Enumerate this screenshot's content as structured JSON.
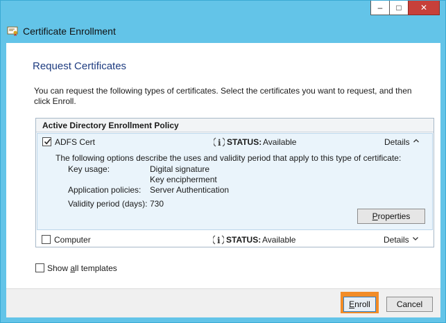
{
  "window": {
    "title": "Certificate Enrollment",
    "controls": {
      "minimize": "–",
      "maximize": "□",
      "close": "✕"
    }
  },
  "page": {
    "heading": "Request Certificates",
    "description": "You can request the following types of certificates. Select the certificates you want to request, and then click Enroll."
  },
  "policy": {
    "header": "Active Directory Enrollment Policy",
    "items": [
      {
        "name": "ADFS Cert",
        "checked": true,
        "status_label": "STATUS:",
        "status_value": "Available",
        "details_label": "Details",
        "expanded": true,
        "options_description": "The following options describe the uses and validity period that apply to this type of certificate:",
        "key_usage_label": "Key usage:",
        "key_usage_values": [
          "Digital signature",
          "Key encipherment"
        ],
        "app_policies_label": "Application policies:",
        "app_policies_value": "Server Authentication",
        "validity_label": "Validity period (days):",
        "validity_value": "730",
        "properties_button": {
          "prefix": "",
          "accel": "P",
          "rest": "roperties"
        }
      },
      {
        "name": "Computer",
        "checked": false,
        "status_label": "STATUS:",
        "status_value": "Available",
        "details_label": "Details",
        "expanded": false
      }
    ]
  },
  "show_all": {
    "prefix": "Show ",
    "accel": "a",
    "rest": "ll templates",
    "checked": false
  },
  "footer": {
    "enroll": {
      "prefix": "",
      "accel": "E",
      "rest": "nroll"
    },
    "cancel": "Cancel"
  },
  "colors": {
    "heading": "#1e3c80",
    "titlebar": "#63c4e8",
    "highlight": "#f28c28",
    "close": "#c7403a"
  }
}
